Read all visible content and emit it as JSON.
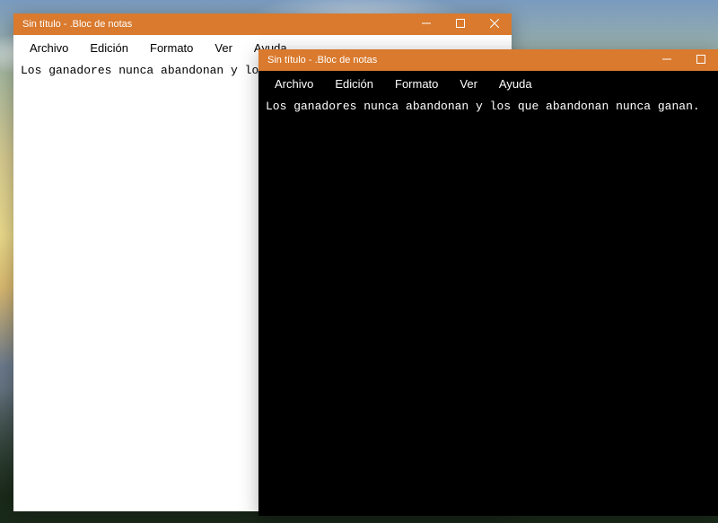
{
  "windows": [
    {
      "id": "w1",
      "title": "Sin título - .Bloc de notas",
      "menu": {
        "archivo": "Archivo",
        "edicion": "Edición",
        "formato": "Formato",
        "ver": "Ver",
        "ayuda": "Ayuda"
      },
      "text": "Los ganadores nunca abandonan y los que"
    },
    {
      "id": "w2",
      "title": "Sin título - .Bloc de notas",
      "menu": {
        "archivo": "Archivo",
        "edicion": "Edición",
        "formato": "Formato",
        "ver": "Ver",
        "ayuda": "Ayuda"
      },
      "text": "Los ganadores nunca abandonan y los que abandonan nunca ganan."
    }
  ]
}
